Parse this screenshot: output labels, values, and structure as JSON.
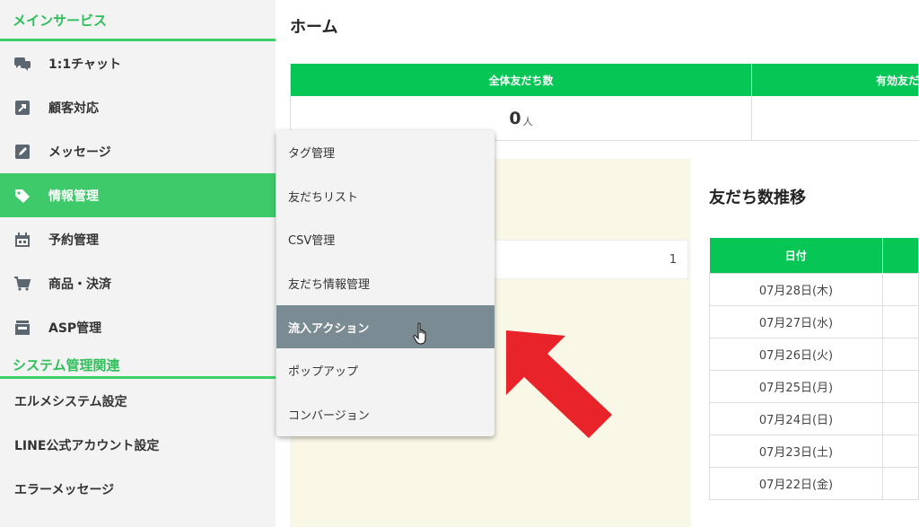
{
  "sidebar": {
    "main_section": "メインサービス",
    "items": [
      {
        "label": "1:1チャット",
        "icon": "chat-bubbles-icon"
      },
      {
        "label": "顧客対応",
        "icon": "arrow-box-icon"
      },
      {
        "label": "メッセージ",
        "icon": "pen-box-icon"
      },
      {
        "label": "情報管理",
        "icon": "tag-icon"
      },
      {
        "label": "予約管理",
        "icon": "calendar-icon"
      },
      {
        "label": "商品・決済",
        "icon": "cart-icon"
      },
      {
        "label": "ASP管理",
        "icon": "inbox-icon"
      }
    ],
    "system_section": "システム管理関連",
    "system_items": [
      "エルメシステム設定",
      "LINE公式アカウント設定",
      "エラーメッセージ"
    ]
  },
  "main": {
    "title": "ホーム",
    "stats": {
      "col1_header": "全体友だち数",
      "col2_header": "有効友だ",
      "col1_value": "0",
      "col1_unit": "人"
    },
    "table_row_value": "1",
    "trend": {
      "title": "友だち数推移",
      "date_header": "日付",
      "dates": [
        "07月28日(木)",
        "07月27日(水)",
        "07月26日(火)",
        "07月25日(月)",
        "07月24日(日)",
        "07月23日(土)",
        "07月22日(金)"
      ]
    }
  },
  "dropdown": {
    "items": [
      "タグ管理",
      "友だちリスト",
      "CSV管理",
      "友だち情報管理",
      "流入アクション",
      "ポップアップ",
      "コンバージョン"
    ],
    "hovered": "流入アクション"
  },
  "colors": {
    "line_green": "#06c755",
    "sidebar_active": "#3ec96a",
    "dropdown_hover": "#7a8b93",
    "arrow_red": "#e8232a"
  }
}
